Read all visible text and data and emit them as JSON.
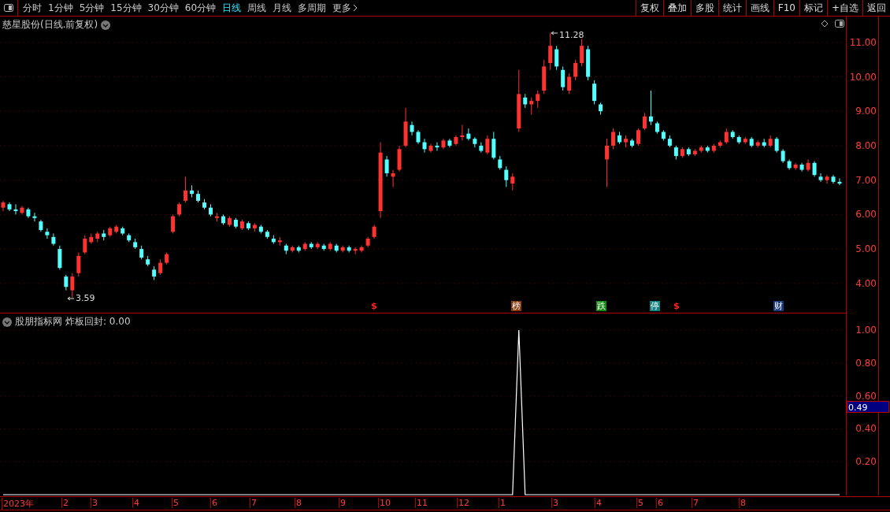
{
  "toolbar": {
    "tabs": [
      {
        "label": "分时",
        "selected": false
      },
      {
        "label": "1分钟",
        "selected": false
      },
      {
        "label": "5分钟",
        "selected": false
      },
      {
        "label": "15分钟",
        "selected": false
      },
      {
        "label": "30分钟",
        "selected": false
      },
      {
        "label": "60分钟",
        "selected": false
      },
      {
        "label": "日线",
        "selected": true
      },
      {
        "label": "周线",
        "selected": false
      },
      {
        "label": "月线",
        "selected": false
      },
      {
        "label": "多周期",
        "selected": false
      },
      {
        "label": "更多",
        "selected": false
      }
    ],
    "buttons": [
      "复权",
      "叠加",
      "多股",
      "统计",
      "画线",
      "F10",
      "标记",
      "+自选",
      "返回"
    ]
  },
  "main_chart": {
    "title": "慈星股份(日线.前复权)",
    "high_label": "11.28",
    "low_label": "3.59",
    "chart_data": {
      "type": "candlestick",
      "ylim": [
        3.15,
        11.75
      ],
      "grid": true,
      "yticks": [
        {
          "value": 11,
          "label": "11.00"
        },
        {
          "value": 10,
          "label": "10.00"
        },
        {
          "value": 9,
          "label": "9.00"
        },
        {
          "value": 8,
          "label": "8.00"
        },
        {
          "value": 7,
          "label": "7.00"
        },
        {
          "value": 6,
          "label": "6.00"
        },
        {
          "value": 5,
          "label": "5.00"
        },
        {
          "value": 4,
          "label": "4.00"
        }
      ],
      "ohlc": [
        [
          6.2,
          6.4,
          6.1,
          6.35
        ],
        [
          6.3,
          6.35,
          6.1,
          6.15
        ],
        [
          6.15,
          6.3,
          6.0,
          6.1
        ],
        [
          6.05,
          6.25,
          6.0,
          6.2
        ],
        [
          6.15,
          6.2,
          5.9,
          5.95
        ],
        [
          5.95,
          6.05,
          5.8,
          5.9
        ],
        [
          5.8,
          5.85,
          5.5,
          5.55
        ],
        [
          5.5,
          5.6,
          5.3,
          5.4
        ],
        [
          5.35,
          5.45,
          5.1,
          5.15
        ],
        [
          5.0,
          5.1,
          4.4,
          4.45
        ],
        [
          4.2,
          4.25,
          3.8,
          3.9
        ],
        [
          3.8,
          4.3,
          3.59,
          4.2
        ],
        [
          4.3,
          4.9,
          4.2,
          4.8
        ],
        [
          4.9,
          5.4,
          4.85,
          5.3
        ],
        [
          5.2,
          5.45,
          5.15,
          5.35
        ],
        [
          5.3,
          5.5,
          5.2,
          5.45
        ],
        [
          5.45,
          5.55,
          5.25,
          5.35
        ],
        [
          5.4,
          5.65,
          5.35,
          5.6
        ],
        [
          5.5,
          5.7,
          5.45,
          5.65
        ],
        [
          5.6,
          5.65,
          5.4,
          5.45
        ],
        [
          5.4,
          5.45,
          5.2,
          5.25
        ],
        [
          5.2,
          5.3,
          5.0,
          5.05
        ],
        [
          5.0,
          5.1,
          4.7,
          4.75
        ],
        [
          4.7,
          4.8,
          4.5,
          4.55
        ],
        [
          4.4,
          4.5,
          4.1,
          4.2
        ],
        [
          4.3,
          4.7,
          4.25,
          4.6
        ],
        [
          4.6,
          4.9,
          4.55,
          4.85
        ],
        [
          5.5,
          6.0,
          5.45,
          5.95
        ],
        [
          6.0,
          6.35,
          5.95,
          6.3
        ],
        [
          6.4,
          7.1,
          6.35,
          6.7
        ],
        [
          6.7,
          6.85,
          6.5,
          6.6
        ],
        [
          6.6,
          6.7,
          6.35,
          6.4
        ],
        [
          6.35,
          6.45,
          6.15,
          6.2
        ],
        [
          6.2,
          6.3,
          5.95,
          6.0
        ],
        [
          5.9,
          6.05,
          5.8,
          5.95
        ],
        [
          5.95,
          6.0,
          5.7,
          5.75
        ],
        [
          5.7,
          5.95,
          5.65,
          5.9
        ],
        [
          5.85,
          5.9,
          5.6,
          5.65
        ],
        [
          5.6,
          5.85,
          5.55,
          5.8
        ],
        [
          5.75,
          5.8,
          5.55,
          5.6
        ],
        [
          5.6,
          5.75,
          5.5,
          5.7
        ],
        [
          5.65,
          5.7,
          5.45,
          5.5
        ],
        [
          5.5,
          5.55,
          5.3,
          5.35
        ],
        [
          5.3,
          5.4,
          5.15,
          5.2
        ],
        [
          5.2,
          5.35,
          5.1,
          5.25
        ],
        [
          5.1,
          5.15,
          4.85,
          4.95
        ],
        [
          4.95,
          5.1,
          4.9,
          5.05
        ],
        [
          5.05,
          5.1,
          4.9,
          4.95
        ],
        [
          5.0,
          5.2,
          4.95,
          5.15
        ],
        [
          5.15,
          5.2,
          5.0,
          5.05
        ],
        [
          5.05,
          5.2,
          5.0,
          5.15
        ],
        [
          5.1,
          5.15,
          4.95,
          5.0
        ],
        [
          5.0,
          5.2,
          4.95,
          5.15
        ],
        [
          5.1,
          5.15,
          4.9,
          4.95
        ],
        [
          4.95,
          5.1,
          4.9,
          5.05
        ],
        [
          5.05,
          5.1,
          4.9,
          4.95
        ],
        [
          4.95,
          5.05,
          4.85,
          5.0
        ],
        [
          4.95,
          5.1,
          4.9,
          5.05
        ],
        [
          5.1,
          5.35,
          5.05,
          5.3
        ],
        [
          5.35,
          5.7,
          5.3,
          5.65
        ],
        [
          6.1,
          8.1,
          5.9,
          7.8
        ],
        [
          7.6,
          7.7,
          7.1,
          7.2
        ],
        [
          7.1,
          7.3,
          6.8,
          7.2
        ],
        [
          7.3,
          8.0,
          7.25,
          7.9
        ],
        [
          8.0,
          9.1,
          7.95,
          8.7
        ],
        [
          8.6,
          8.7,
          8.3,
          8.4
        ],
        [
          8.4,
          8.45,
          8.05,
          8.1
        ],
        [
          8.1,
          8.2,
          7.8,
          7.9
        ],
        [
          7.85,
          8.05,
          7.8,
          8.0
        ],
        [
          8.0,
          8.1,
          7.85,
          7.95
        ],
        [
          7.95,
          8.2,
          7.9,
          8.15
        ],
        [
          8.15,
          8.2,
          7.95,
          8.0
        ],
        [
          8.05,
          8.3,
          8.0,
          8.25
        ],
        [
          8.25,
          8.6,
          8.15,
          8.3
        ],
        [
          8.35,
          8.5,
          8.15,
          8.2
        ],
        [
          8.2,
          8.25,
          7.95,
          8.05
        ],
        [
          8.0,
          8.1,
          7.8,
          7.85
        ],
        [
          7.8,
          8.3,
          7.75,
          8.2
        ],
        [
          8.2,
          8.4,
          7.6,
          7.65
        ],
        [
          7.6,
          7.7,
          7.3,
          7.35
        ],
        [
          7.3,
          7.4,
          6.8,
          7.0
        ],
        [
          6.9,
          7.2,
          6.7,
          7.1
        ],
        [
          8.5,
          10.2,
          8.4,
          9.5
        ],
        [
          9.4,
          9.5,
          9.1,
          9.2
        ],
        [
          9.2,
          9.4,
          8.9,
          9.3
        ],
        [
          9.3,
          9.6,
          9.1,
          9.5
        ],
        [
          9.6,
          10.5,
          9.5,
          10.3
        ],
        [
          10.4,
          11.28,
          10.2,
          10.9
        ],
        [
          10.8,
          10.9,
          10.2,
          10.3
        ],
        [
          10.2,
          10.3,
          9.6,
          9.7
        ],
        [
          9.6,
          10.1,
          9.5,
          10.0
        ],
        [
          10.0,
          10.5,
          9.9,
          10.4
        ],
        [
          10.4,
          11.1,
          10.3,
          10.9
        ],
        [
          10.8,
          10.9,
          9.9,
          10.0
        ],
        [
          9.8,
          9.9,
          9.2,
          9.3
        ],
        [
          9.2,
          9.25,
          8.9,
          9.0
        ],
        [
          7.6,
          8.2,
          6.8,
          8.0
        ],
        [
          8.0,
          8.5,
          7.9,
          8.4
        ],
        [
          8.3,
          8.4,
          8.05,
          8.1
        ],
        [
          8.1,
          8.3,
          7.95,
          8.2
        ],
        [
          8.15,
          8.2,
          7.95,
          8.0
        ],
        [
          8.05,
          8.5,
          8.0,
          8.45
        ],
        [
          8.5,
          8.95,
          8.45,
          8.85
        ],
        [
          8.85,
          9.6,
          8.6,
          8.7
        ],
        [
          8.65,
          8.7,
          8.35,
          8.4
        ],
        [
          8.4,
          8.45,
          8.15,
          8.2
        ],
        [
          8.2,
          8.3,
          7.95,
          8.0
        ],
        [
          7.95,
          8.0,
          7.6,
          7.7
        ],
        [
          7.7,
          7.95,
          7.65,
          7.9
        ],
        [
          7.9,
          7.95,
          7.7,
          7.75
        ],
        [
          7.75,
          7.9,
          7.7,
          7.85
        ],
        [
          7.85,
          8.0,
          7.8,
          7.95
        ],
        [
          7.95,
          8.0,
          7.8,
          7.85
        ],
        [
          7.85,
          8.05,
          7.8,
          8.0
        ],
        [
          8.0,
          8.15,
          7.95,
          8.1
        ],
        [
          8.1,
          8.5,
          8.05,
          8.4
        ],
        [
          8.4,
          8.45,
          8.2,
          8.25
        ],
        [
          8.25,
          8.3,
          8.05,
          8.1
        ],
        [
          8.1,
          8.25,
          8.05,
          8.2
        ],
        [
          8.2,
          8.25,
          7.95,
          8.0
        ],
        [
          8.0,
          8.15,
          7.95,
          8.1
        ],
        [
          8.1,
          8.2,
          7.95,
          8.0
        ],
        [
          8.0,
          8.3,
          7.95,
          8.2
        ],
        [
          8.2,
          8.25,
          7.8,
          7.85
        ],
        [
          7.85,
          7.9,
          7.5,
          7.55
        ],
        [
          7.55,
          7.6,
          7.3,
          7.35
        ],
        [
          7.35,
          7.5,
          7.3,
          7.45
        ],
        [
          7.45,
          7.5,
          7.25,
          7.3
        ],
        [
          7.3,
          7.6,
          7.25,
          7.5
        ],
        [
          7.5,
          7.55,
          7.1,
          7.15
        ],
        [
          7.1,
          7.2,
          6.95,
          7.0
        ],
        [
          7.0,
          7.15,
          6.9,
          7.1
        ],
        [
          7.1,
          7.15,
          6.9,
          6.95
        ],
        [
          6.95,
          7.05,
          6.85,
          6.9
        ]
      ]
    },
    "events": [
      {
        "kind": "dollar",
        "label": "$",
        "color": "#ff2020"
      },
      {
        "kind": "tag",
        "label": "榜",
        "color": "#8b3a10"
      },
      {
        "kind": "tag",
        "label": "跌",
        "color": "#108a10"
      },
      {
        "kind": "tag",
        "label": "停",
        "color": "#108080"
      },
      {
        "kind": "dollar",
        "label": "$",
        "color": "#ff2020"
      },
      {
        "kind": "tag",
        "label": "财",
        "color": "#1a3a7a"
      }
    ]
  },
  "indicator": {
    "title": "股朋指标网",
    "formula": "炸板回封: 0.00",
    "chart_data": {
      "type": "line",
      "ylim": [
        0,
        1.1
      ],
      "grid": true,
      "yticks": [
        {
          "value": 1,
          "label": "1.00"
        },
        {
          "value": 0.8,
          "label": "0.80"
        },
        {
          "value": 0.6,
          "label": "0.60"
        },
        {
          "value": 0.4,
          "label": "0.40"
        },
        {
          "value": 0.2,
          "label": "0.20"
        }
      ],
      "series": [
        {
          "color": "#ffffff",
          "values": [
            0,
            0,
            0,
            0,
            0,
            0,
            0,
            0,
            0,
            0,
            0,
            0,
            0,
            0,
            0,
            0,
            0,
            0,
            0,
            0,
            0,
            0,
            0,
            0,
            0,
            0,
            0,
            0,
            0,
            0,
            0,
            0,
            0,
            0,
            0,
            0,
            0,
            0,
            0,
            0,
            0,
            0,
            0,
            0,
            0,
            0,
            0,
            0,
            0,
            0,
            0,
            0,
            0,
            0,
            0,
            0,
            0,
            0,
            0,
            0,
            0,
            0,
            0,
            0,
            0,
            0,
            0,
            0,
            0,
            0,
            0,
            0,
            0,
            0,
            0,
            0,
            0,
            0,
            0,
            0,
            0,
            0,
            1,
            0,
            0,
            0,
            0,
            0,
            0,
            0,
            0,
            0,
            0,
            0,
            0,
            0,
            0,
            0,
            0,
            0,
            0,
            0,
            0,
            0,
            0,
            0,
            0,
            0,
            0,
            0,
            0,
            0,
            0,
            0,
            0,
            0,
            0,
            0,
            0,
            0,
            0,
            0,
            0,
            0,
            0,
            0,
            0,
            0,
            0,
            0,
            0,
            0,
            0,
            0
          ]
        }
      ]
    },
    "cursor_value": "0.49"
  },
  "date_axis": [
    "2023年",
    "2",
    "3",
    "4",
    "5",
    "6",
    "7",
    "8",
    "9",
    "10",
    "11",
    "12",
    "1",
    "3",
    "4",
    "5",
    "6",
    "7",
    "8"
  ]
}
